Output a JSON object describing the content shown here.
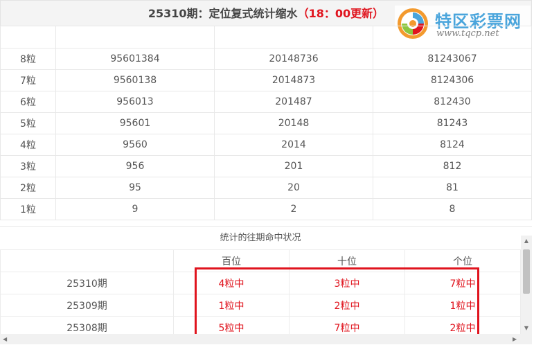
{
  "title": {
    "main": "25310期：定位复式统计缩水",
    "update": "（18：00更新）"
  },
  "logo": {
    "brand": "特区彩票网",
    "url": "www.tqcp.net"
  },
  "upper_table": {
    "rows": [
      {
        "label": "8粒",
        "cells": [
          "95601384",
          "20148736",
          "81243067"
        ]
      },
      {
        "label": "7粒",
        "cells": [
          "9560138",
          "2014873",
          "8124306"
        ]
      },
      {
        "label": "6粒",
        "cells": [
          "956013",
          "201487",
          "812430"
        ]
      },
      {
        "label": "5粒",
        "cells": [
          "95601",
          "20148",
          "81243"
        ]
      },
      {
        "label": "4粒",
        "cells": [
          "9560",
          "2014",
          "8124"
        ]
      },
      {
        "label": "3粒",
        "cells": [
          "956",
          "201",
          "812"
        ]
      },
      {
        "label": "2粒",
        "cells": [
          "95",
          "20",
          "81"
        ]
      },
      {
        "label": "1粒",
        "cells": [
          "9",
          "2",
          "8"
        ]
      }
    ]
  },
  "history": {
    "title": "统计的往期命中状况",
    "headers": [
      "",
      "百位",
      "十位",
      "个位"
    ],
    "rows": [
      {
        "period": "25310期",
        "cells": [
          "4粒中",
          "3粒中",
          "7粒中"
        ]
      },
      {
        "period": "25309期",
        "cells": [
          "1粒中",
          "2粒中",
          "1粒中"
        ]
      },
      {
        "period": "25308期",
        "cells": [
          "5粒中",
          "7粒中",
          "2粒中"
        ]
      }
    ]
  },
  "colors": {
    "accent_red": "#e0141e",
    "logo_blue": "#4aa5dc"
  }
}
